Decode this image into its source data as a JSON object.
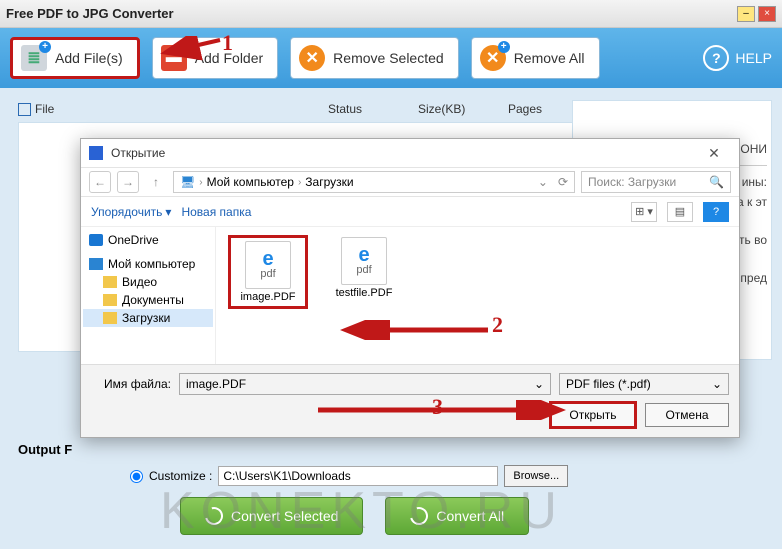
{
  "window": {
    "title": "Free PDF to JPG Converter"
  },
  "toolbar": {
    "add_files": "Add File(s)",
    "add_folder": "Add Folder",
    "remove_selected": "Remove Selected",
    "remove_all": "Remove All",
    "help": "HELP"
  },
  "list": {
    "col_file": "File",
    "col_status": "Status",
    "col_size": "Size(KB)",
    "col_pages": "Pages"
  },
  "right_panel": {
    "l1": "ОНИ",
    "l2": "ины:",
    "l3": "а к эт",
    "l4": "ать во",
    "l5": "а пред"
  },
  "output": {
    "label": "Output F",
    "customize": "Customize :",
    "path": "C:\\Users\\K1\\Downloads",
    "browse": "Browse..."
  },
  "convert": {
    "selected": "Convert Selected",
    "all": "Convert All"
  },
  "dialog": {
    "title": "Открытие",
    "path1": "Мой компьютер",
    "path2": "Загрузки",
    "search_ph": "Поиск: Загрузки",
    "organize": "Упорядочить",
    "new_folder": "Новая папка",
    "tree": {
      "onedrive": "OneDrive",
      "mypc": "Мой компьютер",
      "video": "Видео",
      "docs": "Документы",
      "downloads": "Загрузки"
    },
    "files": {
      "f1": "image.PDF",
      "f2": "testfile.PDF"
    },
    "fn_label": "Имя файла:",
    "fn_value": "image.PDF",
    "type_value": "PDF files (*.pdf)",
    "open": "Открыть",
    "cancel": "Отмена"
  },
  "annotations": {
    "n1": "1",
    "n2": "2",
    "n3": "3"
  },
  "watermark": "KONEKTO.RU"
}
